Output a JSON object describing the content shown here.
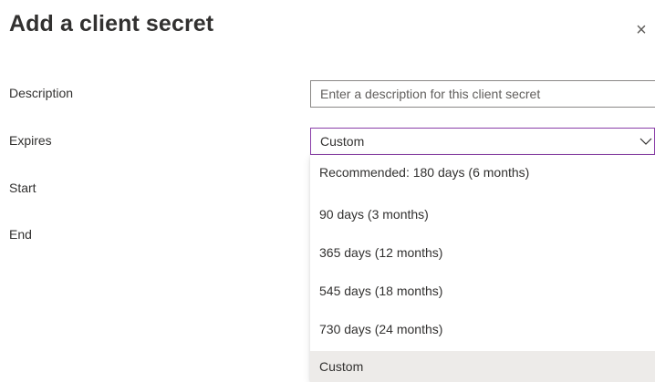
{
  "dialog": {
    "title": "Add a client secret",
    "close_symbol": "×"
  },
  "form": {
    "description": {
      "label": "Description",
      "value": "",
      "placeholder": "Enter a description for this client secret"
    },
    "expires": {
      "label": "Expires",
      "selected": "Custom",
      "options": [
        "Recommended: 180 days (6 months)",
        "90 days (3 months)",
        "365 days (12 months)",
        "545 days (18 months)",
        "730 days (24 months)",
        "Custom"
      ]
    },
    "start": {
      "label": "Start"
    },
    "end": {
      "label": "End"
    }
  },
  "colors": {
    "focus_border": "#8a3ea8",
    "selected_option_bg": "#edebe9"
  },
  "icons": {
    "close": "close-icon",
    "dropdown": "chevron-down-icon"
  }
}
